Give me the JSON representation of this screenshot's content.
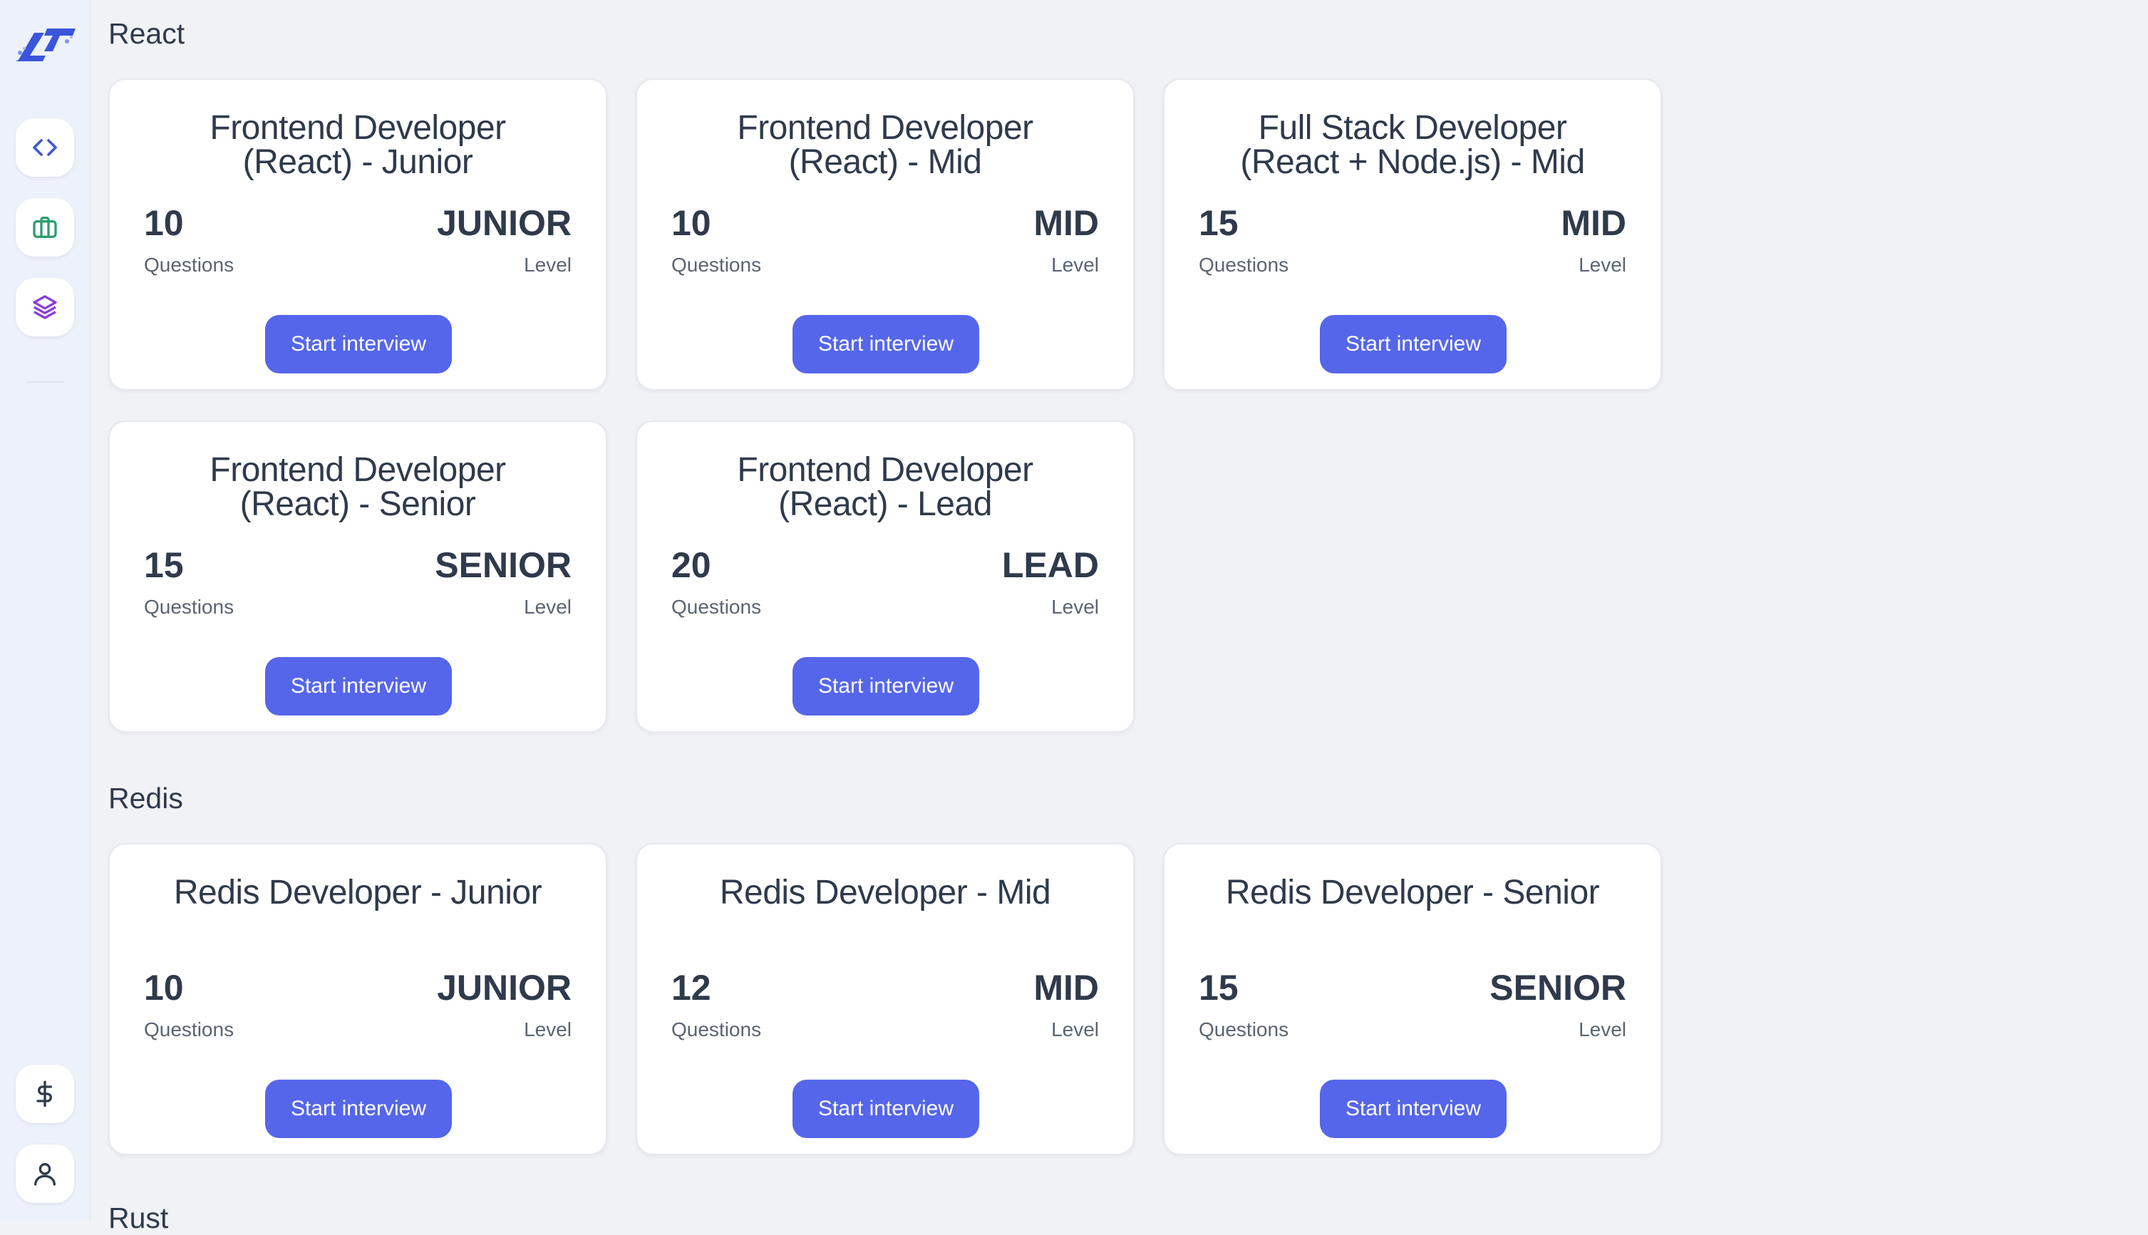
{
  "app": {
    "colors": {
      "accent": "#5566ea",
      "background": "#f1f2f5",
      "sidebar": "#edf1fb"
    }
  },
  "sidebar": {
    "items": [
      {
        "icon": "code-icon"
      },
      {
        "icon": "briefcase-icon"
      },
      {
        "icon": "layers-icon"
      }
    ],
    "bottom_items": [
      {
        "icon": "dollar-icon"
      },
      {
        "icon": "user-icon"
      }
    ]
  },
  "sections": [
    {
      "title": "React",
      "cards": [
        {
          "title_line1": "Frontend Developer",
          "title_line2": "(React) - Junior",
          "questions": "10",
          "questions_label": "Questions",
          "level": "JUNIOR",
          "level_label": "Level",
          "button": "Start interview"
        },
        {
          "title_line1": "Frontend Developer",
          "title_line2": "(React) - Mid",
          "questions": "10",
          "questions_label": "Questions",
          "level": "MID",
          "level_label": "Level",
          "button": "Start interview"
        },
        {
          "title_line1": "Full Stack Developer",
          "title_line2": "(React + Node.js) - Mid",
          "questions": "15",
          "questions_label": "Questions",
          "level": "MID",
          "level_label": "Level",
          "button": "Start interview"
        },
        {
          "title_line1": "Frontend Developer",
          "title_line2": "(React) - Senior",
          "questions": "15",
          "questions_label": "Questions",
          "level": "SENIOR",
          "level_label": "Level",
          "button": "Start interview"
        },
        {
          "title_line1": "Frontend Developer",
          "title_line2": "(React) - Lead",
          "questions": "20",
          "questions_label": "Questions",
          "level": "LEAD",
          "level_label": "Level",
          "button": "Start interview"
        }
      ]
    },
    {
      "title": "Redis",
      "cards": [
        {
          "title_line1": "Redis Developer - Junior",
          "questions": "10",
          "questions_label": "Questions",
          "level": "JUNIOR",
          "level_label": "Level",
          "button": "Start interview"
        },
        {
          "title_line1": "Redis Developer - Mid",
          "questions": "12",
          "questions_label": "Questions",
          "level": "MID",
          "level_label": "Level",
          "button": "Start interview"
        },
        {
          "title_line1": "Redis Developer - Senior",
          "questions": "15",
          "questions_label": "Questions",
          "level": "SENIOR",
          "level_label": "Level",
          "button": "Start interview"
        }
      ]
    },
    {
      "title": "Rust"
    }
  ]
}
